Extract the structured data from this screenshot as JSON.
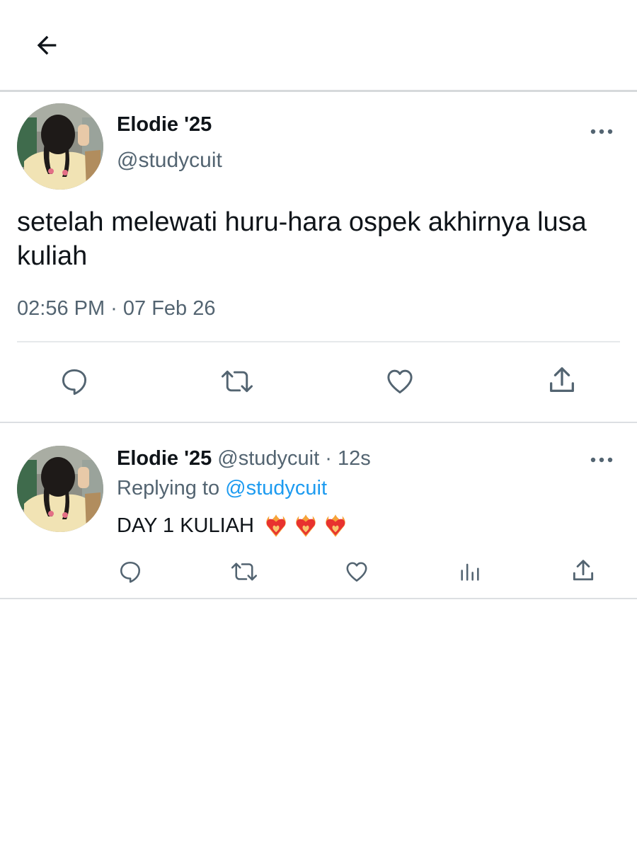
{
  "header": {
    "back_icon": "arrow-left-icon"
  },
  "tweet": {
    "author": {
      "display_name": "Elodie '25",
      "handle": "@studycuit"
    },
    "text": "setelah melewati huru-hara ospek akhirnya lusa kuliah",
    "timestamp": "02:56 PM · 07 Feb 26",
    "actions": [
      "reply-icon",
      "retweet-icon",
      "like-icon",
      "share-icon"
    ]
  },
  "reply": {
    "author": {
      "display_name": "Elodie '25",
      "handle": "@studycuit"
    },
    "separator": "·",
    "age": "12s",
    "replying_to_label": "Replying to",
    "replying_to_handle": "@studycuit",
    "text": "DAY 1 KULIAH",
    "emoji": [
      "heart-on-fire-emoji",
      "heart-on-fire-emoji",
      "heart-on-fire-emoji"
    ],
    "actions": [
      "reply-icon",
      "retweet-icon",
      "like-icon",
      "analytics-icon",
      "share-icon"
    ]
  },
  "colors": {
    "text_primary": "#0f1419",
    "text_secondary": "#536471",
    "accent": "#1d9bf0",
    "divider": "#dcdfe2"
  }
}
